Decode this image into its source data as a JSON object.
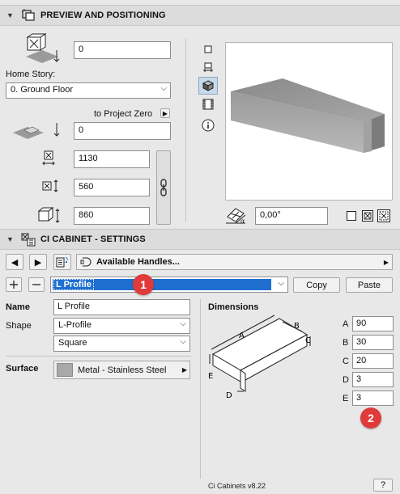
{
  "preview_section": {
    "title": "PREVIEW AND POSITIONING",
    "top_offset_value": "0",
    "home_story_label": "Home Story:",
    "home_story_value": "0. Ground Floor",
    "to_project_zero_label": "to Project Zero",
    "project_zero_value": "0",
    "width_value": "1130",
    "depth_value": "560",
    "height_value": "860",
    "angle_value": "0,00°"
  },
  "settings_section": {
    "title": "CI CABINET - SETTINGS",
    "nav_title": "Available Handles...",
    "profile_value": "L Profile",
    "copy_label": "Copy",
    "paste_label": "Paste",
    "name_label": "Name",
    "name_value": "L Profile",
    "shape_label": "Shape",
    "shape_value": "L-Profile",
    "shape_sub_value": "Square",
    "surface_label": "Surface",
    "surface_value": "Metal - Stainless Steel",
    "dimensions_label": "Dimensions",
    "dims": [
      {
        "label": "A",
        "value": "90"
      },
      {
        "label": "B",
        "value": "30"
      },
      {
        "label": "C",
        "value": "20"
      },
      {
        "label": "D",
        "value": "3"
      },
      {
        "label": "E",
        "value": "3"
      }
    ],
    "diagram_labels": {
      "a": "A",
      "b": "B",
      "c": "C",
      "d": "D",
      "e": "E"
    },
    "version": "Ci Cabinets v8.22",
    "help": "?"
  },
  "badges": {
    "one": "1",
    "two": "2"
  },
  "colors": {
    "badge": "#e03a3a",
    "selection": "#1e6fd0",
    "surface_swatch": "#a9a9a9"
  },
  "icons": {
    "collapse": "triangle-down-icon",
    "preview_header": "preview-positioning-icon",
    "settings_header": "cabinet-settings-icon"
  }
}
